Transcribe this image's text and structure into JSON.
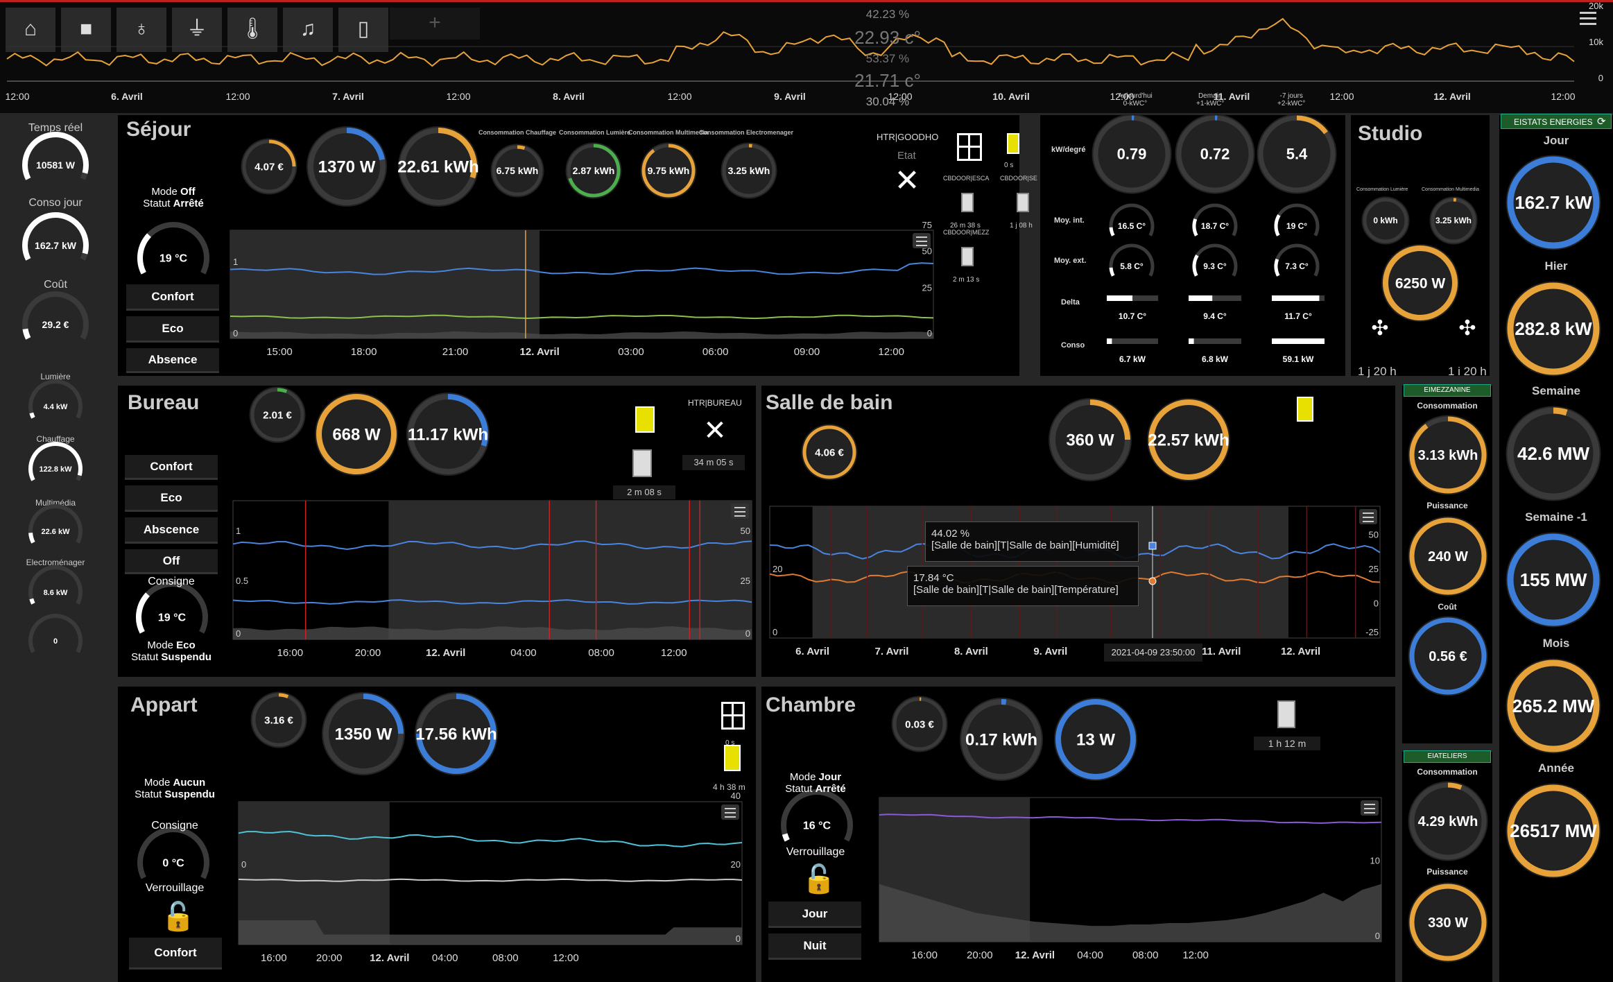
{
  "colors": {
    "orange": "#e8a23a",
    "blue": "#3b7dd8",
    "green": "#4cae4c",
    "track": "#3a3a3a",
    "dark": "#222"
  },
  "topbar": {
    "icons": [
      "house-icon",
      "camera-icon",
      "bulb-icon",
      "plug-icon",
      "thermometer-icon",
      "music-icon",
      "phone-icon"
    ],
    "plus": "+",
    "overlay": [
      "42.23 %",
      "22.93 c°",
      "53.37 %",
      "21.71 c°",
      "30.04 %"
    ],
    "axis": [
      "12:00",
      "6. Avril",
      "12:00",
      "7. Avril",
      "12:00",
      "8. Avril",
      "12:00",
      "9. Avril",
      "12:00",
      "10. Avril",
      "12:00",
      "11. Avril",
      "12:00",
      "12. Avril",
      "12:00"
    ],
    "yticks": [
      "20k",
      "10k",
      "0"
    ],
    "solar": [
      "Aujourd'hui",
      "0-kWC°",
      "Demain",
      "+1-kWC°",
      "-7 jours",
      "+2-kWC°"
    ]
  },
  "left": {
    "temps_reel_label": "Temps réel",
    "temps_reel_value": "10581 W",
    "conso_jour_label": "Conso jour",
    "conso_jour_value": "162.7 kW",
    "cout_label": "Coût",
    "cout_value": "29.2 €",
    "lumiere_label": "Lumière",
    "lumiere_value": "4.4 kW",
    "chauffage_label": "Chauffage",
    "chauffage_value": "122.8 kW",
    "multimedia_label": "Multimédia",
    "multimedia_value": "22.6 kW",
    "electro_label": "Electroménager",
    "electro_value": "8.6 kW",
    "zero_value": "0"
  },
  "sejour": {
    "title": "Séjour",
    "g_cost": "4.07 €",
    "g_power": "1370 W",
    "g_energy": "22.61 kWh",
    "heads": [
      "Consommation Chauffage",
      "Consommation Lumière",
      "Consommation Multimedia",
      "Consommation Electromenager"
    ],
    "g_chauff": "6.75 kWh",
    "g_lum": "2.87 kWh",
    "g_multi": "9.75 kWh",
    "g_elec": "3.25 kWh",
    "mode_line1_a": "Mode ",
    "mode_line1_b": "Off",
    "mode_line2_a": "Statut ",
    "mode_line2_b": "Arrêté",
    "temp": "19 °C",
    "buttons": [
      "Confort",
      "Eco",
      "Absence"
    ],
    "chart_axis": [
      "15:00",
      "18:00",
      "21:00",
      "12. Avril",
      "03:00",
      "06:00",
      "09:00",
      "12:00"
    ],
    "chart_yl": [
      "1",
      "0"
    ],
    "chart_yr": [
      "75",
      "50",
      "25",
      "0"
    ],
    "htr": "HTR|GOODHO",
    "etat": "Etat",
    "doors": {
      "d1": "0 s",
      "d1_label": "CBDOOR|ESCA",
      "d2_label": "CBDOOR|SE",
      "d3": "26 m 38 s",
      "d3_label": "CBDOOR|MEZZ",
      "d4": "1 j 08 h",
      "d5": "2 m 13 s"
    }
  },
  "kwdeg": {
    "header": "kW/degré",
    "rows": [
      "Moy. int.",
      "Moy. ext.",
      "Delta",
      "Conso"
    ],
    "vals": [
      "0.79",
      "0.72",
      "5.4"
    ],
    "int": [
      "16.5 C°",
      "18.7 C°",
      "19 C°"
    ],
    "ext": [
      "5.8 C°",
      "9.3 C°",
      "7.3 C°"
    ],
    "delta": [
      "10.7 C°",
      "9.4 C°",
      "11.7 C°"
    ],
    "conso": [
      "6.7 kW",
      "6.8 kW",
      "59.1 kW"
    ]
  },
  "studio": {
    "title": "Studio",
    "head1": "Consommation Lumière",
    "head2": "Consommation Multimedia",
    "v1": "0 kWh",
    "v2": "3.25 kWh",
    "power": "6250 W",
    "t1": "1 j 20 h",
    "t2": "1 i 20 h"
  },
  "right": {
    "header": "EISTATS ENERGIES",
    "labels": [
      "Jour",
      "Hier",
      "Semaine",
      "Semaine -1",
      "Mois",
      "Année"
    ],
    "values": [
      "162.7 kW",
      "282.8 kW",
      "42.6 MW",
      "155 MW",
      "265.2 MW",
      "26517 MW"
    ]
  },
  "mezz": {
    "header": "EIMEZZANINE",
    "conso_label": "Consommation",
    "conso": "3.13 kWh",
    "puis_label": "Puissance",
    "puis": "240 W",
    "cout_label": "Coût",
    "cout": "0.56 €"
  },
  "ateliers": {
    "header": "EIATELIERS",
    "conso_label": "Consommation",
    "conso": "4.29 kWh",
    "puis_label": "Puissance",
    "puis": "330 W"
  },
  "bureau": {
    "title": "Bureau",
    "g_cost": "2.01 €",
    "g_power": "668 W",
    "g_energy": "11.17 kWh",
    "buttons": [
      "Confort",
      "Eco",
      "Abscence",
      "Off"
    ],
    "consigne": "Consigne",
    "temp": "19 °C",
    "mode_a": "Mode ",
    "mode_b": "Eco",
    "statut_a": "Statut ",
    "statut_b": "Suspendu",
    "door_time": "2 m 08 s",
    "htr": "HTR|BUREAU",
    "htr_time": "34 m 05 s",
    "chart_axis": [
      "16:00",
      "20:00",
      "12. Avril",
      "04:00",
      "08:00",
      "12:00"
    ],
    "chart_yl": [
      "1",
      "0.5",
      "0"
    ],
    "chart_yr": [
      "50",
      "25",
      "0"
    ]
  },
  "sdb": {
    "title": "Salle de bain",
    "g_cost": "4.06 €",
    "g_power": "360 W",
    "g_energy": "22.57 kWh",
    "tip1_val": "44.02 %",
    "tip1_name": "[Salle de bain][T|Salle de bain][Humidité]",
    "tip2_val": "17.84 °C",
    "tip2_name": "[Salle de bain][T|Salle de bain][Température]",
    "date_tip": "2021-04-09 23:50:00",
    "chart_axis": [
      "6. Avril",
      "7. Avril",
      "8. Avril",
      "9. Avril",
      "11. Avril",
      "12. Avril"
    ],
    "chart_yl": [
      "20",
      "0"
    ],
    "chart_yr": [
      "50",
      "25",
      "0",
      "-25"
    ]
  },
  "appart": {
    "title": "Appart",
    "g_cost": "3.16 €",
    "g_power": "1350 W",
    "g_energy": "17.56 kWh",
    "mode_a": "Mode ",
    "mode_b": "Aucun",
    "statut_a": "Statut ",
    "statut_b": "Suspendu",
    "consigne": "Consigne",
    "temp": "0 °C",
    "verrou": "Verrouillage",
    "button": "Confort",
    "door_time": "4 h 38 m",
    "door_top": "0 s",
    "chart_axis": [
      "16:00",
      "20:00",
      "12. Avril",
      "04:00",
      "08:00",
      "12:00"
    ],
    "chart_yl": [
      "0"
    ],
    "chart_yr": [
      "40",
      "20",
      "0"
    ]
  },
  "chambre": {
    "title": "Chambre",
    "g_cost": "0.03 €",
    "g_energy": "0.17 kWh",
    "g_power": "13 W",
    "mode_a": "Mode ",
    "mode_b": "Jour",
    "statut_a": "Statut ",
    "statut_b": "Arrêté",
    "temp": "16 °C",
    "verrou": "Verrouillage",
    "buttons": [
      "Jour",
      "Nuit"
    ],
    "door_time": "1 h 12 m",
    "chart_axis": [
      "16:00",
      "20:00",
      "12. Avril",
      "04:00",
      "08:00",
      "12:00"
    ],
    "chart_yr": [
      "10",
      "0"
    ]
  }
}
